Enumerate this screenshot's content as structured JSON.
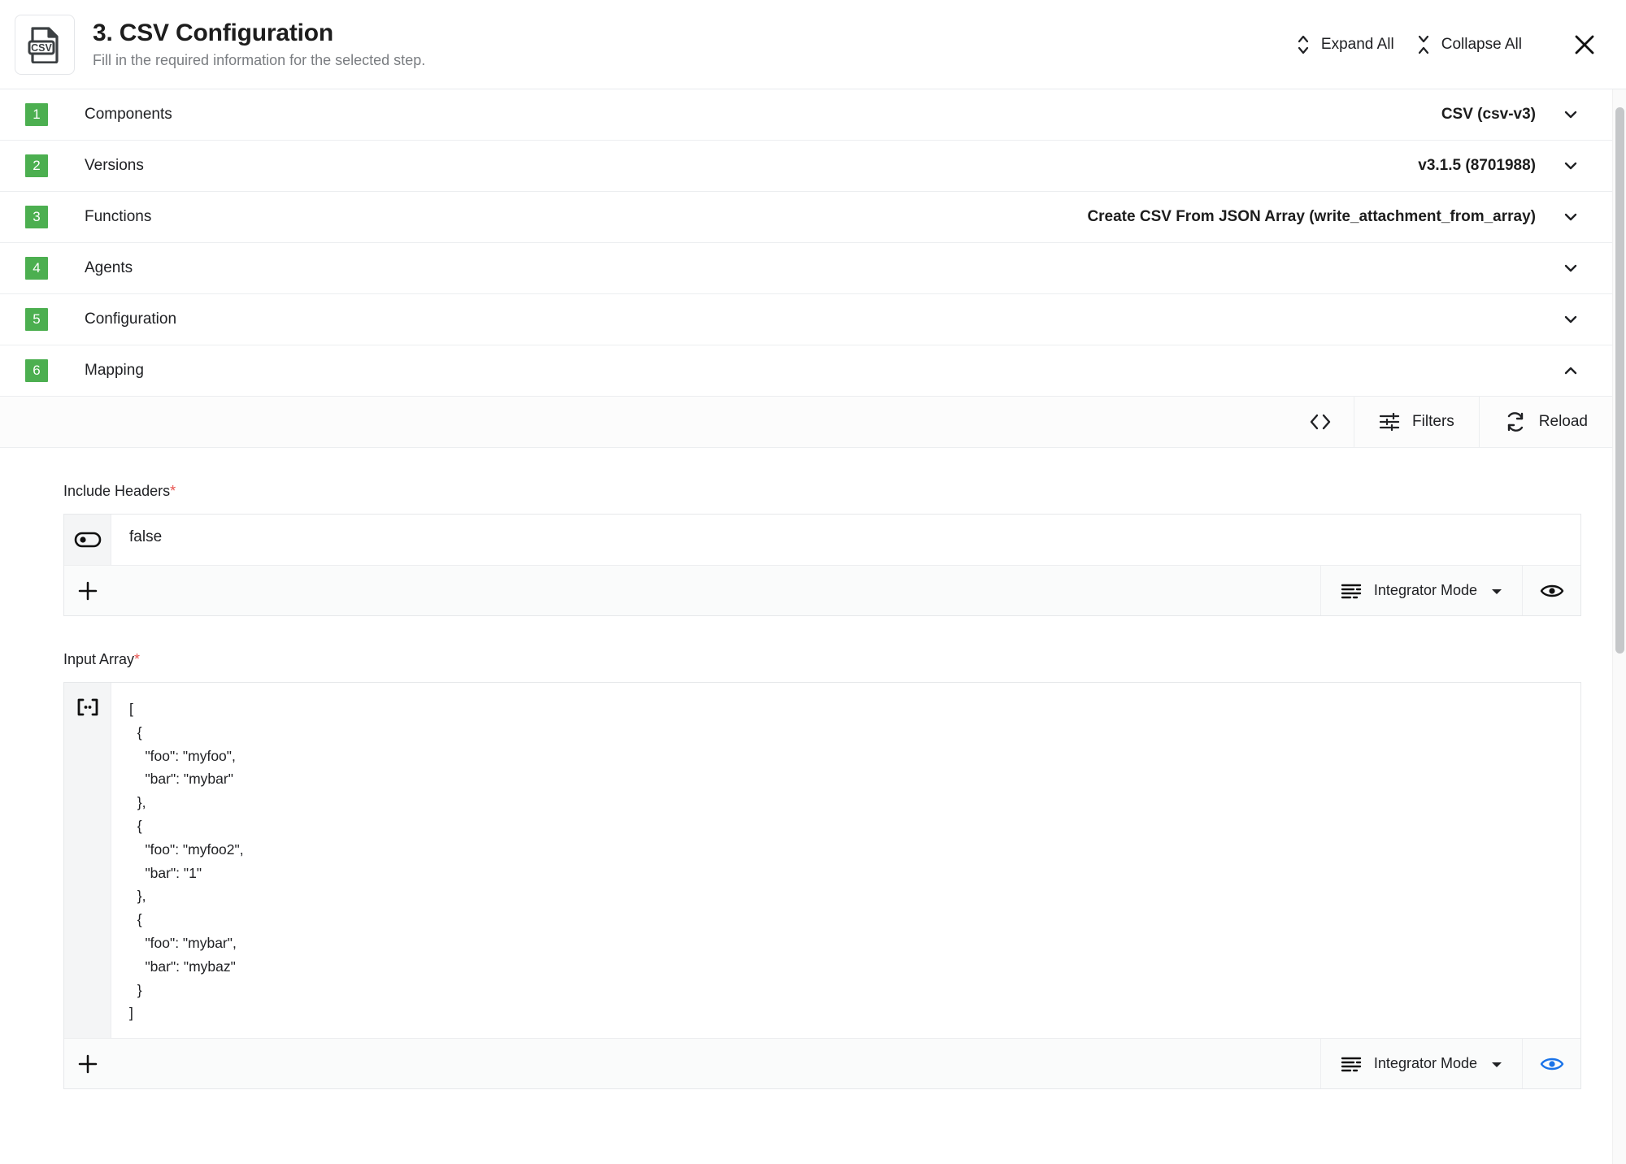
{
  "header": {
    "icon": "csv-file-icon",
    "icon_label": "CSV",
    "title": "3. CSV Configuration",
    "subtitle": "Fill in the required information for the selected step.",
    "expand_all_label": "Expand All",
    "expand_all_icon": "expand-vertical-icon",
    "collapse_all_label": "Collapse All",
    "collapse_all_icon": "collapse-vertical-icon",
    "close_icon": "close-icon"
  },
  "accordion": {
    "rows": [
      {
        "number": "1",
        "label": "Components",
        "value": "CSV (csv-v3)",
        "chevron": "chevron-down-icon",
        "expanded": false
      },
      {
        "number": "2",
        "label": "Versions",
        "value": "v3.1.5 (8701988)",
        "chevron": "chevron-down-icon",
        "expanded": false
      },
      {
        "number": "3",
        "label": "Functions",
        "value": "Create CSV From JSON Array (write_attachment_from_array)",
        "chevron": "chevron-down-icon",
        "expanded": false
      },
      {
        "number": "4",
        "label": "Agents",
        "value": "",
        "chevron": "chevron-down-icon",
        "expanded": false
      },
      {
        "number": "5",
        "label": "Configuration",
        "value": "",
        "chevron": "chevron-down-icon",
        "expanded": false
      },
      {
        "number": "6",
        "label": "Mapping",
        "value": "",
        "chevron": "chevron-up-icon",
        "expanded": true
      }
    ]
  },
  "mapping_toolbar": {
    "code_icon": "code-brackets-icon",
    "filters_label": "Filters",
    "filters_icon": "filters-sliders-icon",
    "reload_label": "Reload",
    "reload_icon": "reload-refresh-icon"
  },
  "fields": [
    {
      "label": "Include Headers",
      "required_marker": "*",
      "type_icon": "boolean-toggle-icon",
      "value": "false",
      "add_icon": "plus-icon",
      "mode_label": "Integrator Mode",
      "mode_icon": "integrator-mode-lines-icon",
      "mode_caret": "caret-down-icon",
      "eye_icon": "eye-icon",
      "eye_active": false
    },
    {
      "label": "Input Array",
      "required_marker": "*",
      "type_icon": "array-brackets-icon",
      "value": "[\n  {\n    \"foo\": \"myfoo\",\n    \"bar\": \"mybar\"\n  },\n  {\n    \"foo\": \"myfoo2\",\n    \"bar\": \"1\"\n  },\n  {\n    \"foo\": \"mybar\",\n    \"bar\": \"mybaz\"\n  }\n]",
      "add_icon": "plus-icon",
      "mode_label": "Integrator Mode",
      "mode_icon": "integrator-mode-lines-icon",
      "mode_caret": "caret-down-icon",
      "eye_icon": "eye-icon",
      "eye_active": true
    }
  ],
  "colors": {
    "step_badge_green": "#4caf50",
    "required_red": "#e8534f",
    "eye_active_blue": "#1a73e8",
    "text_primary": "#202124",
    "text_muted": "#7a7d81",
    "border": "#e6e8ea"
  },
  "scrollbar": {
    "orientation": "vertical",
    "thumb_position": "near-top"
  }
}
